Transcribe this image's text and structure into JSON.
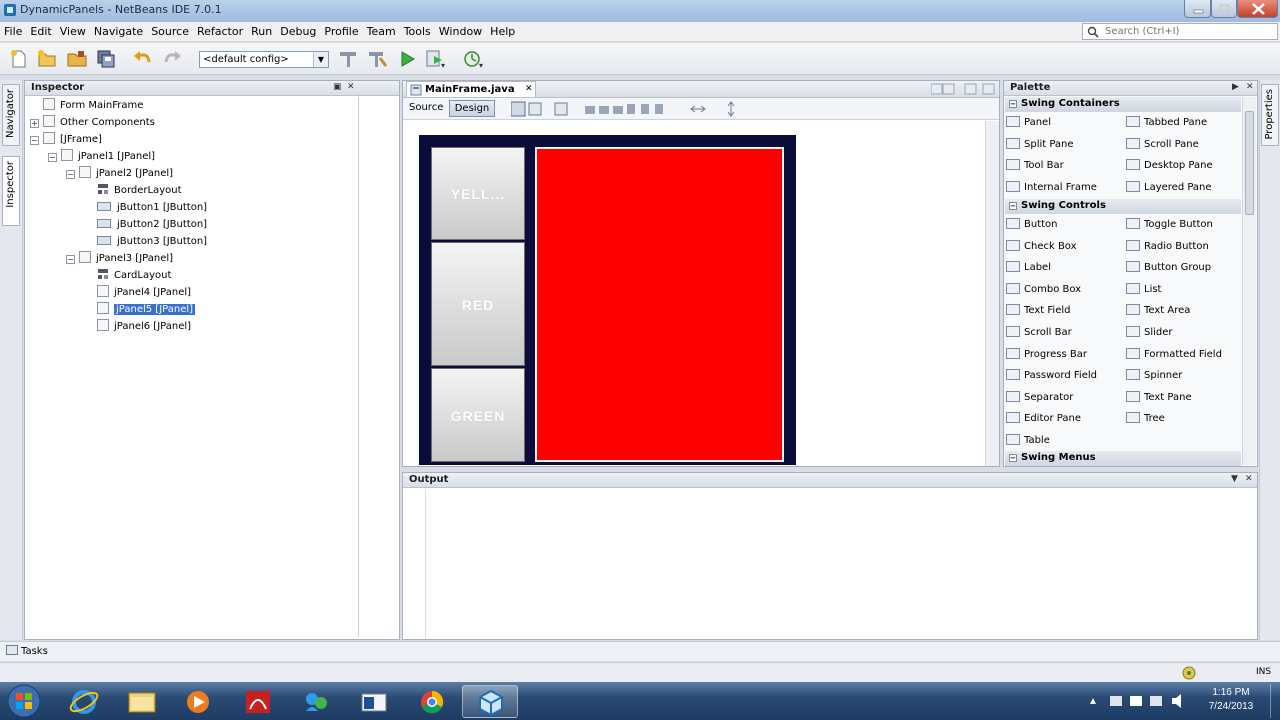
{
  "window": {
    "title": "DynamicPanels - NetBeans IDE 7.0.1"
  },
  "menu": [
    "File",
    "Edit",
    "View",
    "Navigate",
    "Source",
    "Refactor",
    "Run",
    "Debug",
    "Profile",
    "Team",
    "Tools",
    "Window",
    "Help"
  ],
  "search": {
    "placeholder": "Search (Ctrl+I)"
  },
  "toolbar": {
    "config": "<default config>"
  },
  "side_tabs": {
    "navigator": "Navigator",
    "inspector": "Inspector",
    "properties": "Properties"
  },
  "inspector": {
    "title": "Inspector",
    "tree": [
      {
        "label": "Form MainFrame"
      },
      {
        "label": "Other Components"
      },
      {
        "label": "[JFrame]"
      },
      {
        "label": "jPanel1 [JPanel]"
      },
      {
        "label": "jPanel2 [JPanel]"
      },
      {
        "label": "BorderLayout"
      },
      {
        "label": "jButton1 [JButton]"
      },
      {
        "label": "jButton2 [JButton]"
      },
      {
        "label": "jButton3 [JButton]"
      },
      {
        "label": "jPanel3 [JPanel]"
      },
      {
        "label": "CardLayout"
      },
      {
        "label": "jPanel4 [JPanel]"
      },
      {
        "label": "jPanel5 [JPanel]",
        "selected": true
      },
      {
        "label": "jPanel6 [JPanel]"
      }
    ]
  },
  "editor": {
    "tab": "MainFrame.java",
    "source": "Source",
    "design": "Design",
    "buttons": [
      "YELL...",
      "RED",
      "GREEN"
    ],
    "panel_color": "#ff0000"
  },
  "palette": {
    "title": "Palette",
    "sections": {
      "containers": "Swing Containers",
      "controls": "Swing Controls",
      "menus": "Swing Menus"
    },
    "containers": [
      "Panel",
      "Tabbed Pane",
      "Split Pane",
      "Scroll Pane",
      "Tool Bar",
      "Desktop Pane",
      "Internal Frame",
      "Layered Pane"
    ],
    "controls": [
      "Button",
      "Toggle Button",
      "Check Box",
      "Radio Button",
      "Label",
      "Button Group",
      "Combo Box",
      "List",
      "Text Field",
      "Text Area",
      "Scroll Bar",
      "Slider",
      "Progress Bar",
      "Formatted Field",
      "Password Field",
      "Spinner",
      "Separator",
      "Text Pane",
      "Editor Pane",
      "Tree",
      "Table"
    ]
  },
  "output": {
    "title": "Output"
  },
  "tasks": {
    "label": "Tasks"
  },
  "status": {
    "ins": "INS"
  },
  "taskbar": {
    "time": "1:16 PM",
    "date": "7/24/2013"
  }
}
